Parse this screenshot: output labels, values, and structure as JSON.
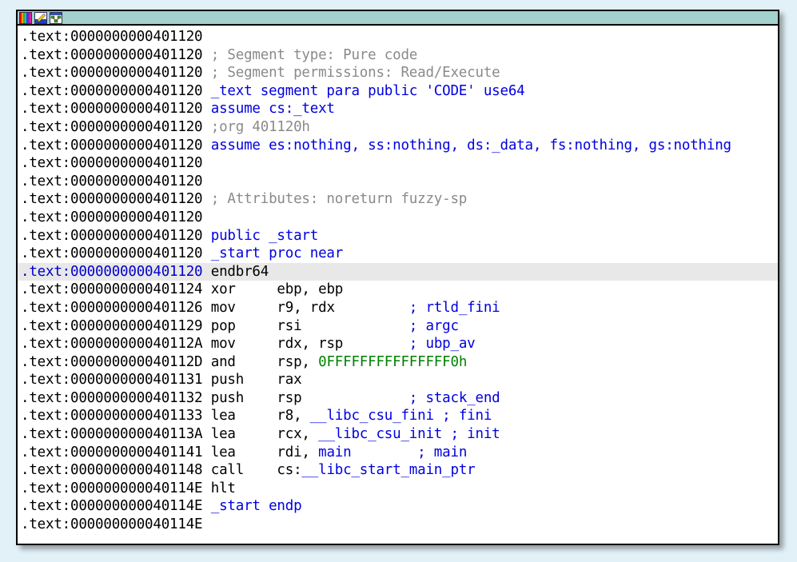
{
  "window": {
    "title": "",
    "titlebar_color": "#a2d1ce",
    "background_color": "#ffffff",
    "page_background": "#e2f1f8",
    "icons": [
      {
        "name": "color-palette-icon",
        "label": "palette"
      },
      {
        "name": "pencil-edit-icon",
        "label": "edit"
      },
      {
        "name": "graph-chart-icon",
        "label": "graph"
      }
    ]
  },
  "colors": {
    "address": "#000000",
    "address_selected": "#0000cc",
    "directive": "#0000e0",
    "comment": "#8a8a8a",
    "auto_comment": "#0000e0",
    "instruction": "#000000",
    "symbol": "#0000e0",
    "number": "#008000",
    "highlight_bg": "#e8e8e8"
  },
  "listing": {
    "segment": ".text",
    "lines": [
      {
        "addr": ".text:0000000000401120",
        "parts": []
      },
      {
        "addr": ".text:0000000000401120",
        "parts": [
          {
            "t": "comment",
            "s": "; Segment type: Pure code"
          }
        ]
      },
      {
        "addr": ".text:0000000000401120",
        "parts": [
          {
            "t": "comment",
            "s": "; Segment permissions: Read/Execute"
          }
        ]
      },
      {
        "addr": ".text:0000000000401120",
        "parts": [
          {
            "t": "seg-dir",
            "s": "_text segment para public 'CODE' use64"
          }
        ]
      },
      {
        "addr": ".text:0000000000401120",
        "parts": [
          {
            "t": "seg-dir",
            "s": "assume cs:_text"
          }
        ]
      },
      {
        "addr": ".text:0000000000401120",
        "parts": [
          {
            "t": "comment",
            "s": ";org 401120h"
          }
        ]
      },
      {
        "addr": ".text:0000000000401120",
        "parts": [
          {
            "t": "seg-dir",
            "s": "assume es:nothing, ss:nothing, ds:_data, fs:nothing, gs:nothing"
          }
        ]
      },
      {
        "addr": ".text:0000000000401120",
        "parts": []
      },
      {
        "addr": ".text:0000000000401120",
        "parts": []
      },
      {
        "addr": ".text:0000000000401120",
        "parts": [
          {
            "t": "comment",
            "s": "; Attributes: noreturn fuzzy-sp"
          }
        ]
      },
      {
        "addr": ".text:0000000000401120",
        "parts": []
      },
      {
        "addr": ".text:0000000000401120",
        "parts": [
          {
            "t": "seg-dir",
            "s": "public _start"
          }
        ]
      },
      {
        "addr": ".text:0000000000401120",
        "parts": [
          {
            "t": "proc",
            "s": "_start proc near"
          }
        ]
      },
      {
        "addr": ".text:0000000000401120",
        "highlight": true,
        "parts": [
          {
            "t": "mnem",
            "s": "endbr64"
          }
        ]
      },
      {
        "addr": ".text:0000000000401124",
        "parts": [
          {
            "t": "mnem",
            "s": "xor"
          },
          {
            "t": "op",
            "s": "     ebp, ebp"
          }
        ]
      },
      {
        "addr": ".text:0000000000401126",
        "parts": [
          {
            "t": "mnem",
            "s": "mov"
          },
          {
            "t": "op",
            "s": "     r9, rdx"
          },
          {
            "t": "auto-cmt",
            "s": "         ; rtld_fini"
          }
        ]
      },
      {
        "addr": ".text:0000000000401129",
        "parts": [
          {
            "t": "mnem",
            "s": "pop"
          },
          {
            "t": "op",
            "s": "     rsi"
          },
          {
            "t": "auto-cmt",
            "s": "             ; argc"
          }
        ]
      },
      {
        "addr": ".text:000000000040112A",
        "parts": [
          {
            "t": "mnem",
            "s": "mov"
          },
          {
            "t": "op",
            "s": "     rdx, rsp"
          },
          {
            "t": "auto-cmt",
            "s": "        ; ubp_av"
          }
        ]
      },
      {
        "addr": ".text:000000000040112D",
        "parts": [
          {
            "t": "mnem",
            "s": "and"
          },
          {
            "t": "op",
            "s": "     rsp, "
          },
          {
            "t": "num",
            "s": "0FFFFFFFFFFFFFFF0h"
          }
        ]
      },
      {
        "addr": ".text:0000000000401131",
        "parts": [
          {
            "t": "mnem",
            "s": "push"
          },
          {
            "t": "op",
            "s": "    rax"
          }
        ]
      },
      {
        "addr": ".text:0000000000401132",
        "parts": [
          {
            "t": "mnem",
            "s": "push"
          },
          {
            "t": "op",
            "s": "    rsp"
          },
          {
            "t": "auto-cmt",
            "s": "             ; stack_end"
          }
        ]
      },
      {
        "addr": ".text:0000000000401133",
        "parts": [
          {
            "t": "mnem",
            "s": "lea"
          },
          {
            "t": "op",
            "s": "     r8, "
          },
          {
            "t": "sym",
            "s": "__libc_csu_fini"
          },
          {
            "t": "auto-cmt",
            "s": " ; fini"
          }
        ]
      },
      {
        "addr": ".text:000000000040113A",
        "parts": [
          {
            "t": "mnem",
            "s": "lea"
          },
          {
            "t": "op",
            "s": "     rcx, "
          },
          {
            "t": "sym",
            "s": "__libc_csu_init"
          },
          {
            "t": "auto-cmt",
            "s": " ; init"
          }
        ]
      },
      {
        "addr": ".text:0000000000401141",
        "parts": [
          {
            "t": "mnem",
            "s": "lea"
          },
          {
            "t": "op",
            "s": "     rdi, "
          },
          {
            "t": "sym",
            "s": "main"
          },
          {
            "t": "auto-cmt",
            "s": "        ; main"
          }
        ]
      },
      {
        "addr": ".text:0000000000401148",
        "parts": [
          {
            "t": "mnem",
            "s": "call"
          },
          {
            "t": "op",
            "s": "    cs:"
          },
          {
            "t": "sym",
            "s": "__libc_start_main_ptr"
          }
        ]
      },
      {
        "addr": ".text:000000000040114E",
        "parts": [
          {
            "t": "mnem",
            "s": "hlt"
          }
        ]
      },
      {
        "addr": ".text:000000000040114E",
        "parts": [
          {
            "t": "proc",
            "s": "_start endp"
          }
        ]
      },
      {
        "addr": ".text:000000000040114E",
        "parts": []
      }
    ]
  }
}
